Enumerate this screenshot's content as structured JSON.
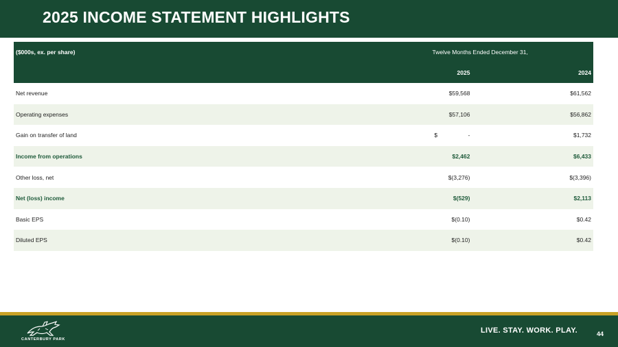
{
  "header": {
    "title": "2025 INCOME STATEMENT HIGHLIGHTS"
  },
  "table": {
    "units_label": "($000s, ex. per share)",
    "period_label": "Twelve Months Ended December 31,",
    "col_2025": "2025",
    "col_2024": "2024",
    "rows": [
      {
        "label": "Net revenue",
        "v2025": "$59,568",
        "v2024": "$61,562"
      },
      {
        "label": "Operating expenses",
        "v2025": "$57,106",
        "v2024": "$56,862"
      },
      {
        "label": "Gain on transfer of land",
        "v2025_currency": "$",
        "v2025": "-",
        "v2024": "$1,732"
      },
      {
        "label": "Income from operations",
        "v2025": "$2,462",
        "v2024": "$6,433"
      },
      {
        "label": "Other loss, net",
        "v2025": "$(3,276)",
        "v2024": "$(3,396)"
      },
      {
        "label": "Net (loss) income",
        "v2025": "$(529)",
        "v2024": "$2,113"
      },
      {
        "label": "Basic EPS",
        "v2025": "$(0.10)",
        "v2024": "$0.42"
      },
      {
        "label": "Diluted EPS",
        "v2025": "$(0.10)",
        "v2024": "$0.42"
      }
    ]
  },
  "footer": {
    "logo_text": "CANTERBURY PARK",
    "tagline": "LIVE. STAY. WORK. PLAY.",
    "page_number": "44"
  },
  "colors": {
    "brand_green": "#184a33",
    "gold": "#c9a227",
    "row_shade": "#eef3e9",
    "highlight_text": "#1e5a3a"
  }
}
